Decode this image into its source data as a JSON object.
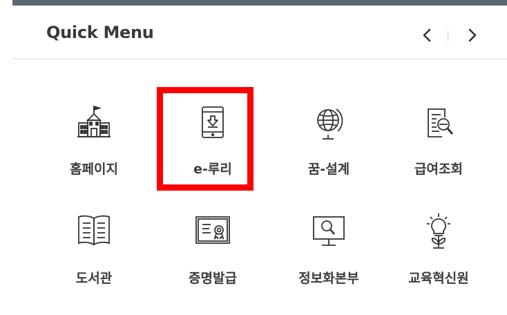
{
  "header": {
    "title": "Quick Menu",
    "prev_icon": "chevron-left-icon",
    "next_icon": "chevron-right-icon"
  },
  "menu": {
    "items": [
      {
        "label": "홈페이지",
        "icon": "school-building-icon"
      },
      {
        "label": "e-루리",
        "icon": "tablet-download-icon"
      },
      {
        "label": "꿈-설계",
        "icon": "globe-icon"
      },
      {
        "label": "급여조회",
        "icon": "document-search-icon"
      },
      {
        "label": "도서관",
        "icon": "open-book-icon"
      },
      {
        "label": "증명발급",
        "icon": "certificate-icon"
      },
      {
        "label": "정보화본부",
        "icon": "monitor-search-icon"
      },
      {
        "label": "교육혁신원",
        "icon": "lightbulb-sprout-icon"
      }
    ]
  },
  "colors": {
    "top_border": "#5f6776",
    "highlight": "#ff0000",
    "text": "#3a3a3a"
  }
}
